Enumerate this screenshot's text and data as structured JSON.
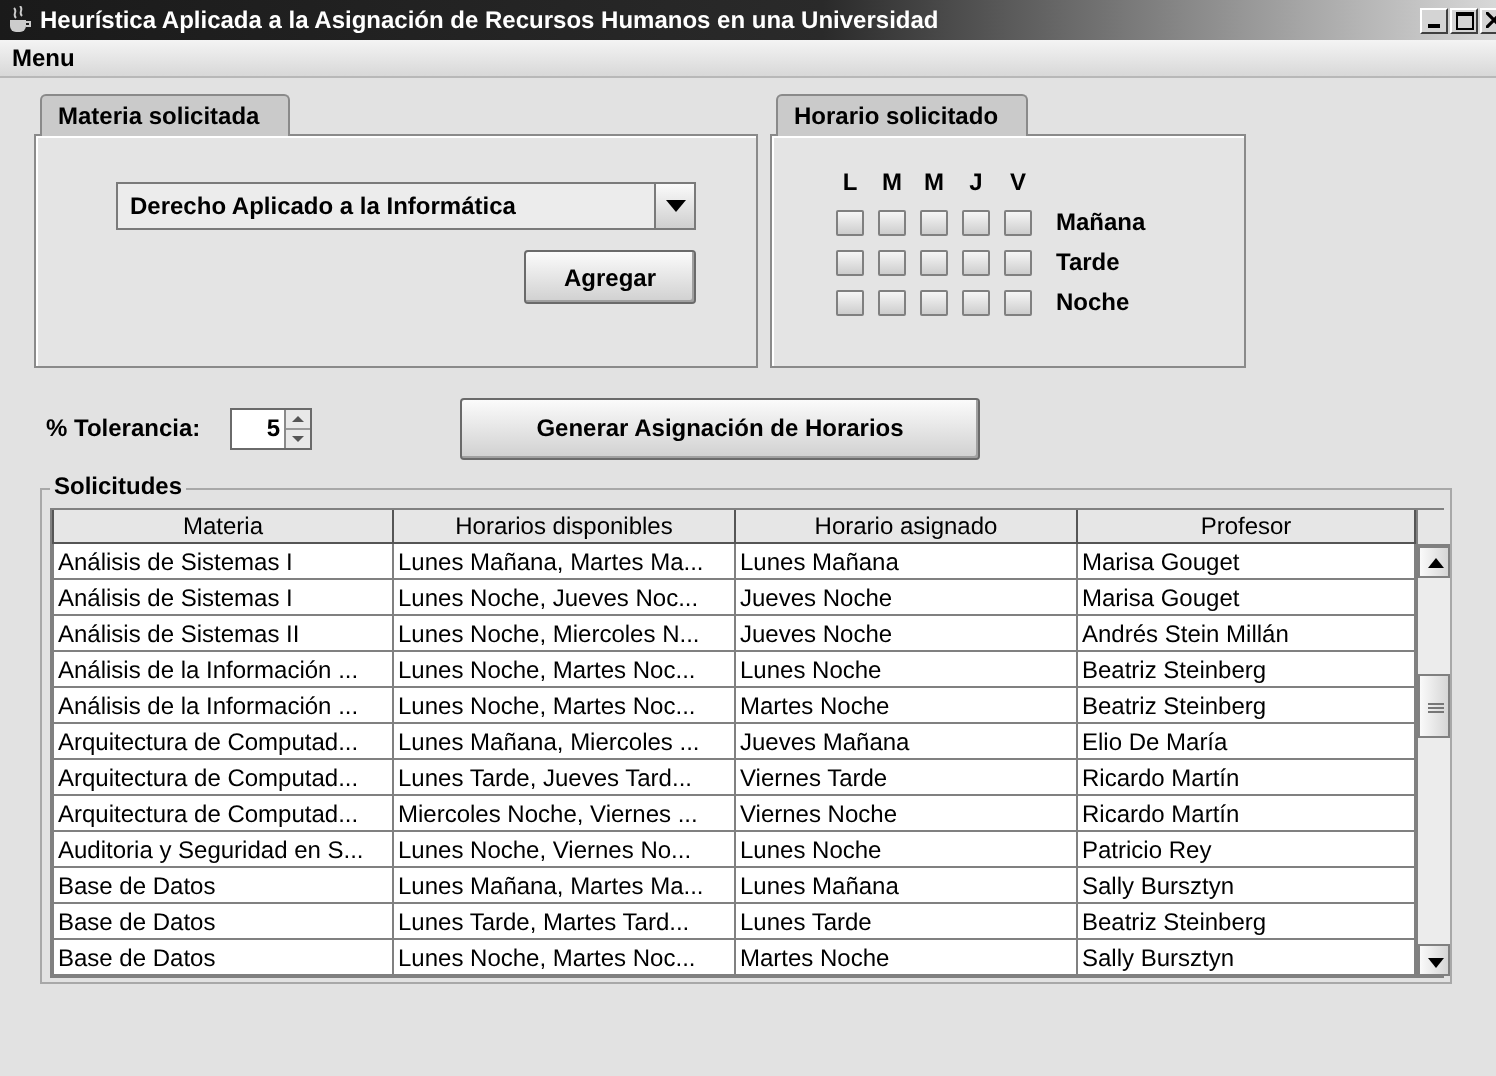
{
  "window": {
    "title": "Heurística Aplicada a la Asignación de Recursos Humanos en una Universidad"
  },
  "menu_bar": [
    "Menu"
  ],
  "materia_panel": {
    "tab": "Materia solicitada",
    "combo_value": "Derecho Aplicado a la Informática",
    "button": "Agregar"
  },
  "horario_panel": {
    "tab": "Horario solicitado",
    "days": [
      "L",
      "M",
      "M",
      "J",
      "V"
    ],
    "shifts": [
      {
        "label": "Mañana",
        "checked": [
          false,
          false,
          false,
          false,
          false
        ]
      },
      {
        "label": "Tarde",
        "checked": [
          false,
          false,
          false,
          false,
          false
        ]
      },
      {
        "label": "Noche",
        "checked": [
          false,
          false,
          false,
          false,
          false
        ]
      }
    ]
  },
  "tolerancia": {
    "label": "% Tolerancia:",
    "value": "5"
  },
  "generate_button": "Generar Asignación de Horarios",
  "solicitudes": {
    "title": "Solicitudes",
    "columns": [
      "Materia",
      "Horarios disponibles",
      "Horario asignado",
      "Profesor"
    ],
    "rows": [
      [
        "Análisis de Sistemas I",
        "Lunes Mañana, Martes Ma...",
        "Lunes Mañana",
        "Marisa Gouget"
      ],
      [
        "Análisis de Sistemas I",
        "Lunes Noche, Jueves Noc...",
        "Jueves Noche",
        "Marisa Gouget"
      ],
      [
        "Análisis de Sistemas II",
        "Lunes Noche, Miercoles N...",
        "Jueves Noche",
        "Andrés Stein Millán"
      ],
      [
        "Análisis de la Información ...",
        "Lunes Noche, Martes Noc...",
        "Lunes Noche",
        "Beatriz Steinberg"
      ],
      [
        "Análisis de la Información ...",
        "Lunes Noche, Martes Noc...",
        "Martes Noche",
        "Beatriz Steinberg"
      ],
      [
        "Arquitectura de Computad...",
        "Lunes Mañana, Miercoles ...",
        "Jueves Mañana",
        "Elio De María"
      ],
      [
        "Arquitectura de Computad...",
        "Lunes Tarde, Jueves Tard...",
        "Viernes Tarde",
        "Ricardo Martín"
      ],
      [
        "Arquitectura de Computad...",
        "Miercoles Noche, Viernes ...",
        "Viernes Noche",
        "Ricardo Martín"
      ],
      [
        "Auditoria y Seguridad en S...",
        "Lunes Noche, Viernes No...",
        "Lunes Noche",
        "Patricio Rey"
      ],
      [
        "Base de Datos",
        "Lunes Mañana, Martes Ma...",
        "Lunes Mañana",
        "Sally Bursztyn"
      ],
      [
        "Base de Datos",
        "Lunes Tarde, Martes Tard...",
        "Lunes Tarde",
        "Beatriz Steinberg"
      ],
      [
        "Base de Datos",
        "Lunes Noche, Martes Noc...",
        "Martes Noche",
        "Sally Bursztyn"
      ]
    ]
  }
}
